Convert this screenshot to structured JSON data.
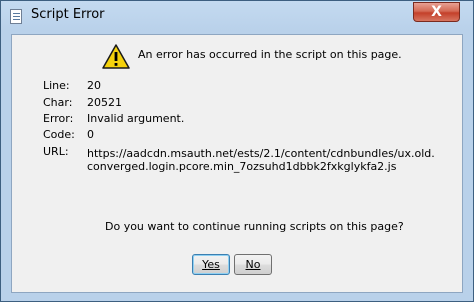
{
  "window": {
    "title": "Script Error",
    "close_glyph": "X"
  },
  "dialog": {
    "message": "An error has occurred in the script on this page.",
    "icon": "warning-icon",
    "fields": {
      "line_label": "Line:",
      "line_value": "20",
      "char_label": "Char:",
      "char_value": "20521",
      "error_label": "Error:",
      "error_value": "Invalid argument.",
      "code_label": "Code:",
      "code_value": "0",
      "url_label": "URL:",
      "url_value_line1": "https://aadcdn.msauth.net/ests/2.1/content/cdnbundles/ux.old.",
      "url_value_line2": "converged.login.pcore.min_7ozsuhd1dbbk2fxkglykfa2.js"
    },
    "question": "Do you want to continue running scripts on this page?",
    "buttons": {
      "yes_label": "Yes",
      "no_label": "No"
    }
  },
  "colors": {
    "frame": "#b9d1ea",
    "content_bg": "#f0f0f0",
    "close_red": "#c4402a",
    "warning_yellow": "#f5d20c"
  }
}
